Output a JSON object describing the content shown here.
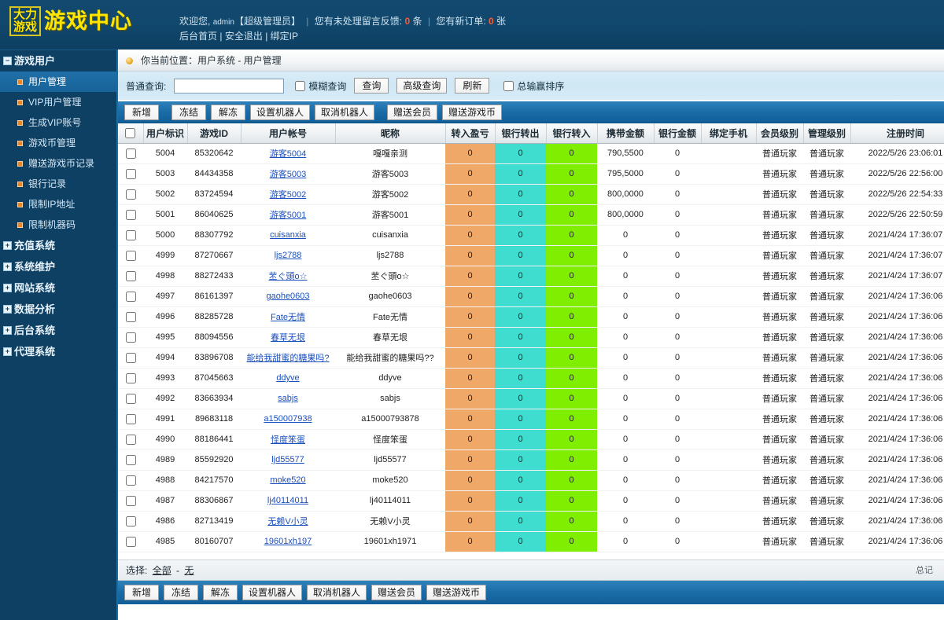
{
  "header": {
    "logo_box_line1": "大力",
    "logo_box_line2": "游戏",
    "logo_main": "游戏中心",
    "welcome_prefix": "欢迎您,",
    "welcome_user": "admin",
    "welcome_role": "【超级管理员】",
    "msg_label": "您有未处理留言反馈:",
    "msg_count": "0",
    "msg_unit": "条",
    "order_label": "您有新订单:",
    "order_count": "0",
    "order_unit": "张",
    "link_home": "后台首页",
    "link_logout": "安全退出",
    "link_bindip": "绑定IP"
  },
  "sidebar": {
    "groups": [
      {
        "label": "游戏用户",
        "toggle": "−",
        "expanded": true,
        "items": [
          {
            "label": "用户管理",
            "active": true
          },
          {
            "label": "VIP用户管理",
            "active": false
          },
          {
            "label": "生成VIP账号",
            "active": false
          },
          {
            "label": "游戏币管理",
            "active": false
          },
          {
            "label": "赠送游戏币记录",
            "active": false
          },
          {
            "label": "银行记录",
            "active": false
          },
          {
            "label": "限制IP地址",
            "active": false
          },
          {
            "label": "限制机器码",
            "active": false
          }
        ]
      },
      {
        "label": "充值系统",
        "toggle": "+",
        "expanded": false,
        "items": []
      },
      {
        "label": "系统维护",
        "toggle": "+",
        "expanded": false,
        "items": []
      },
      {
        "label": "网站系统",
        "toggle": "+",
        "expanded": false,
        "items": []
      },
      {
        "label": "数据分析",
        "toggle": "+",
        "expanded": false,
        "items": []
      },
      {
        "label": "后台系统",
        "toggle": "+",
        "expanded": false,
        "items": []
      },
      {
        "label": "代理系统",
        "toggle": "+",
        "expanded": false,
        "items": []
      }
    ]
  },
  "breadcrumb": {
    "text": "你当前位置：用户系统 - 用户管理"
  },
  "search": {
    "label": "普通查询:",
    "value": "",
    "fuzzy_label": "模糊查询",
    "fuzzy_checked": false,
    "btn_query": "查询",
    "btn_advanced": "高级查询",
    "btn_refresh": "刷新",
    "sort_label": "总输赢排序",
    "sort_checked": false
  },
  "toolbar": {
    "buttons": [
      {
        "label": "新增",
        "sep_after": true
      },
      {
        "label": "冻结",
        "sep_after": false
      },
      {
        "label": "解冻",
        "sep_after": false
      },
      {
        "label": "设置机器人",
        "sep_after": false
      },
      {
        "label": "取消机器人",
        "sep_after": true
      },
      {
        "label": "赠送会员",
        "sep_after": false
      },
      {
        "label": "赠送游戏币",
        "sep_after": false
      }
    ]
  },
  "table": {
    "columns": [
      "用户标识",
      "游戏ID",
      "用户帐号",
      "昵称",
      "转入盈亏",
      "银行转出",
      "银行转入",
      "携带金额",
      "银行金额",
      "绑定手机",
      "会员级别",
      "管理级别",
      "注册时间"
    ],
    "rows": [
      {
        "uid": "5004",
        "gid": "85320642",
        "acct": "游客5004",
        "nick": "嘎嘎亲测",
        "pl": "0",
        "bank_out": "0",
        "bank_in": "0",
        "carry": "790,5500",
        "bank": "0",
        "phone": "",
        "member": "普通玩家",
        "manager": "普通玩家",
        "reg": "2022/5/26 23:06:01"
      },
      {
        "uid": "5003",
        "gid": "84434358",
        "acct": "游客5003",
        "nick": "游客5003",
        "pl": "0",
        "bank_out": "0",
        "bank_in": "0",
        "carry": "795,5000",
        "bank": "0",
        "phone": "",
        "member": "普通玩家",
        "manager": "普通玩家",
        "reg": "2022/5/26 22:56:00"
      },
      {
        "uid": "5002",
        "gid": "83724594",
        "acct": "游客5002",
        "nick": "游客5002",
        "pl": "0",
        "bank_out": "0",
        "bank_in": "0",
        "carry": "800,0000",
        "bank": "0",
        "phone": "",
        "member": "普通玩家",
        "manager": "普通玩家",
        "reg": "2022/5/26 22:54:33"
      },
      {
        "uid": "5001",
        "gid": "86040625",
        "acct": "游客5001",
        "nick": "游客5001",
        "pl": "0",
        "bank_out": "0",
        "bank_in": "0",
        "carry": "800,0000",
        "bank": "0",
        "phone": "",
        "member": "普通玩家",
        "manager": "普通玩家",
        "reg": "2022/5/26 22:50:59"
      },
      {
        "uid": "5000",
        "gid": "88307792",
        "acct": "cuisanxia",
        "nick": "cuisanxia",
        "pl": "0",
        "bank_out": "0",
        "bank_in": "0",
        "carry": "0",
        "bank": "0",
        "phone": "",
        "member": "普通玩家",
        "manager": "普通玩家",
        "reg": "2021/4/24 17:36:07"
      },
      {
        "uid": "4999",
        "gid": "87270667",
        "acct": "ljs2788",
        "nick": "ljs2788",
        "pl": "0",
        "bank_out": "0",
        "bank_in": "0",
        "carry": "0",
        "bank": "0",
        "phone": "",
        "member": "普通玩家",
        "manager": "普通玩家",
        "reg": "2021/4/24 17:36:07"
      },
      {
        "uid": "4998",
        "gid": "88272433",
        "acct": "苤ぐ頭o☆",
        "nick": "苤ぐ頭o☆",
        "pl": "0",
        "bank_out": "0",
        "bank_in": "0",
        "carry": "0",
        "bank": "0",
        "phone": "",
        "member": "普通玩家",
        "manager": "普通玩家",
        "reg": "2021/4/24 17:36:07"
      },
      {
        "uid": "4997",
        "gid": "86161397",
        "acct": "gaohe0603",
        "nick": "gaohe0603",
        "pl": "0",
        "bank_out": "0",
        "bank_in": "0",
        "carry": "0",
        "bank": "0",
        "phone": "",
        "member": "普通玩家",
        "manager": "普通玩家",
        "reg": "2021/4/24 17:36:06"
      },
      {
        "uid": "4996",
        "gid": "88285728",
        "acct": "Fate无情",
        "nick": "Fate无情",
        "pl": "0",
        "bank_out": "0",
        "bank_in": "0",
        "carry": "0",
        "bank": "0",
        "phone": "",
        "member": "普通玩家",
        "manager": "普通玩家",
        "reg": "2021/4/24 17:36:06"
      },
      {
        "uid": "4995",
        "gid": "88094556",
        "acct": "春草无垠",
        "nick": "春草无垠",
        "pl": "0",
        "bank_out": "0",
        "bank_in": "0",
        "carry": "0",
        "bank": "0",
        "phone": "",
        "member": "普通玩家",
        "manager": "普通玩家",
        "reg": "2021/4/24 17:36:06"
      },
      {
        "uid": "4994",
        "gid": "83896708",
        "acct": "能给我甜蜜的糖果吗?",
        "nick": "能给我甜蜜的糖果吗??",
        "pl": "0",
        "bank_out": "0",
        "bank_in": "0",
        "carry": "0",
        "bank": "0",
        "phone": "",
        "member": "普通玩家",
        "manager": "普通玩家",
        "reg": "2021/4/24 17:36:06"
      },
      {
        "uid": "4993",
        "gid": "87045663",
        "acct": "ddyve",
        "nick": "ddyve",
        "pl": "0",
        "bank_out": "0",
        "bank_in": "0",
        "carry": "0",
        "bank": "0",
        "phone": "",
        "member": "普通玩家",
        "manager": "普通玩家",
        "reg": "2021/4/24 17:36:06"
      },
      {
        "uid": "4992",
        "gid": "83663934",
        "acct": "sabjs",
        "nick": "sabjs",
        "pl": "0",
        "bank_out": "0",
        "bank_in": "0",
        "carry": "0",
        "bank": "0",
        "phone": "",
        "member": "普通玩家",
        "manager": "普通玩家",
        "reg": "2021/4/24 17:36:06"
      },
      {
        "uid": "4991",
        "gid": "89683118",
        "acct": "a150007938",
        "nick": "a15000793878",
        "pl": "0",
        "bank_out": "0",
        "bank_in": "0",
        "carry": "0",
        "bank": "0",
        "phone": "",
        "member": "普通玩家",
        "manager": "普通玩家",
        "reg": "2021/4/24 17:36:06"
      },
      {
        "uid": "4990",
        "gid": "88186441",
        "acct": "怪度笨蛋",
        "nick": "怪度笨蛋",
        "pl": "0",
        "bank_out": "0",
        "bank_in": "0",
        "carry": "0",
        "bank": "0",
        "phone": "",
        "member": "普通玩家",
        "manager": "普通玩家",
        "reg": "2021/4/24 17:36:06"
      },
      {
        "uid": "4989",
        "gid": "85592920",
        "acct": "ljd55577",
        "nick": "ljd55577",
        "pl": "0",
        "bank_out": "0",
        "bank_in": "0",
        "carry": "0",
        "bank": "0",
        "phone": "",
        "member": "普通玩家",
        "manager": "普通玩家",
        "reg": "2021/4/24 17:36:06"
      },
      {
        "uid": "4988",
        "gid": "84217570",
        "acct": "moke520",
        "nick": "moke520",
        "pl": "0",
        "bank_out": "0",
        "bank_in": "0",
        "carry": "0",
        "bank": "0",
        "phone": "",
        "member": "普通玩家",
        "manager": "普通玩家",
        "reg": "2021/4/24 17:36:06"
      },
      {
        "uid": "4987",
        "gid": "88306867",
        "acct": "lj40114011",
        "nick": "lj40114011",
        "pl": "0",
        "bank_out": "0",
        "bank_in": "0",
        "carry": "0",
        "bank": "0",
        "phone": "",
        "member": "普通玩家",
        "manager": "普通玩家",
        "reg": "2021/4/24 17:36:06"
      },
      {
        "uid": "4986",
        "gid": "82713419",
        "acct": "无赖V小灵",
        "nick": "无赖V小灵",
        "pl": "0",
        "bank_out": "0",
        "bank_in": "0",
        "carry": "0",
        "bank": "0",
        "phone": "",
        "member": "普通玩家",
        "manager": "普通玩家",
        "reg": "2021/4/24 17:36:06"
      },
      {
        "uid": "4985",
        "gid": "80160707",
        "acct": "19601xh197",
        "nick": "19601xh1971",
        "pl": "0",
        "bank_out": "0",
        "bank_in": "0",
        "carry": "0",
        "bank": "0",
        "phone": "",
        "member": "普通玩家",
        "manager": "普通玩家",
        "reg": "2021/4/24 17:36:06"
      }
    ]
  },
  "selectbar": {
    "label": "选择:",
    "all": "全部",
    "dash": "-",
    "none": "无",
    "right_cut": "总记"
  },
  "colors": {
    "header_bg": "#0e4063",
    "accent_blue": "#1a6ca7",
    "logo_yellow": "#ffe600",
    "profit_orange": "#f0a868",
    "bank_out_teal": "#3fddd0",
    "bank_in_green": "#80ee00",
    "link_blue": "#1a4fbf"
  }
}
